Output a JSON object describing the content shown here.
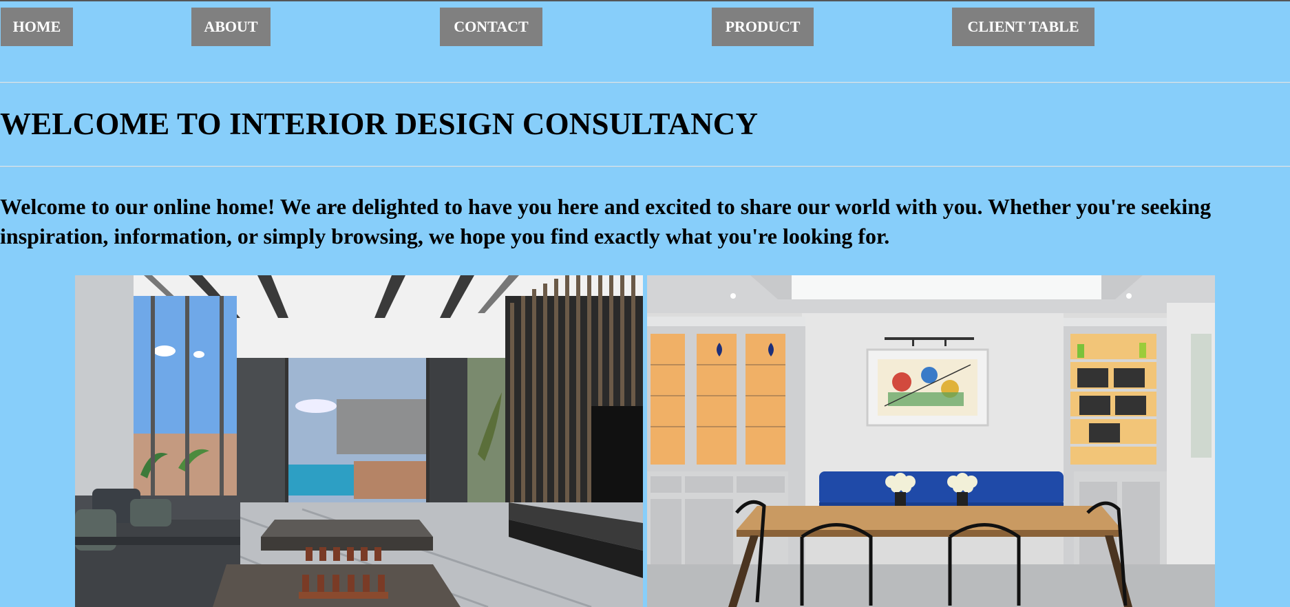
{
  "nav": {
    "home": "HOME",
    "about": "ABOUT",
    "contact": "CONTACT",
    "product": "PRODUCT",
    "client_table": "CLIENT TABLE"
  },
  "main": {
    "heading": "WELCOME TO INTERIOR DESIGN CONSULTANCY",
    "intro": "Welcome to our online home! We are delighted to have you here and excited to share our world with you. Whether you're seeking inspiration, information, or simply browsing, we hope you find exactly what you're looking for."
  },
  "colors": {
    "background": "#87cefa",
    "nav_button": "#808080",
    "nav_text": "#ffffff"
  }
}
